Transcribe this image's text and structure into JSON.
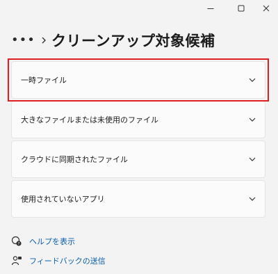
{
  "window": {
    "controls": {
      "minimize_icon": "minimize-icon",
      "maximize_icon": "maximize-icon",
      "close_icon": "close-icon"
    }
  },
  "header": {
    "overflow": "•••",
    "separator_icon": "chevron-right-icon",
    "title": "クリーンアップ対象候補"
  },
  "sections": [
    {
      "label": "一時ファイル",
      "icon": "chevron-down-icon",
      "highlighted": true
    },
    {
      "label": "大きなファイルまたは未使用のファイル",
      "icon": "chevron-down-icon",
      "highlighted": false
    },
    {
      "label": "クラウドに同期されたファイル",
      "icon": "chevron-down-icon",
      "highlighted": false
    },
    {
      "label": "使用されていないアプリ",
      "icon": "chevron-down-icon",
      "highlighted": false
    }
  ],
  "links": {
    "help": {
      "label": "ヘルプを表示",
      "icon": "help-icon"
    },
    "feedback": {
      "label": "フィードバックの送信",
      "icon": "feedback-icon"
    }
  },
  "colors": {
    "background": "#f3f3f3",
    "card": "#fbfbfb",
    "highlight": "#e02020",
    "link": "#0b5ea8"
  }
}
